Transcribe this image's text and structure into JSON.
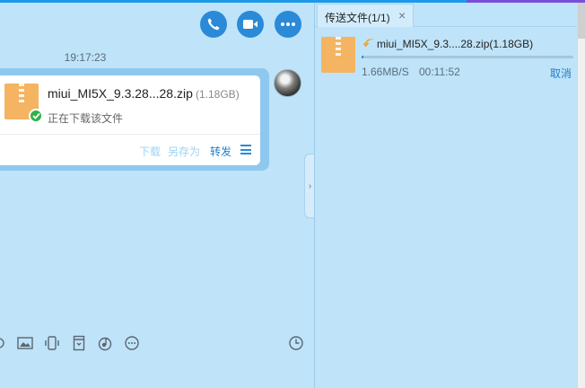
{
  "chat": {
    "timestamp": "19:17:23",
    "message": {
      "file_name": "miui_MI5X_9.3.28...28.zip",
      "file_size": "(1.18GB)",
      "status": "正在下载该文件",
      "actions": {
        "download": "下载",
        "save_as": "另存为",
        "forward": "转发"
      }
    },
    "header_icons": [
      "phone-icon",
      "video-camera-icon",
      "more-icon"
    ],
    "toolbar_icons": [
      "screenshot-icon",
      "image-icon",
      "shake-icon",
      "file-icon",
      "music-icon",
      "more-icon",
      "history-icon"
    ]
  },
  "transfer_panel": {
    "tab_label": "传送文件(1/1)",
    "close_label": "×",
    "item": {
      "name": "miui_MI5X_9.3....28.zip(1.18GB)",
      "speed": "1.66MB/S",
      "elapsed": "00:11:52",
      "cancel_label": "取消",
      "progress": 0.01
    }
  },
  "colors": {
    "background": "#bfe3f9",
    "accent": "#2a8ad7",
    "zip": "#f4b462",
    "success": "#2eb24a"
  }
}
